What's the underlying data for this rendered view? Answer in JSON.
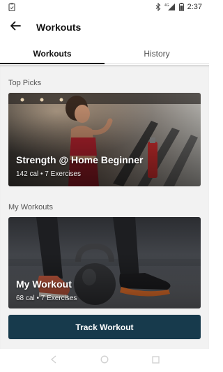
{
  "status_bar": {
    "time": "2:37",
    "network": "4G",
    "icons": [
      "clipboard-check-icon",
      "bluetooth-icon",
      "signal-icon",
      "battery-icon"
    ]
  },
  "app_bar": {
    "title": "Workouts",
    "back_icon": "arrow-left-icon"
  },
  "tabs": [
    {
      "label": "Workouts",
      "active": true
    },
    {
      "label": "History",
      "active": false
    }
  ],
  "top_picks": {
    "title": "Top Picks",
    "card": {
      "title": "Strength @ Home Beginner",
      "subtitle": "142 cal • 7 Exercises",
      "image": "woman-on-treadmill-gym-photo"
    }
  },
  "my_workouts": {
    "title": "My Workouts",
    "card": {
      "title": "My Workout",
      "subtitle": "68 cal • 7 Exercises",
      "image": "kettlebell-and-sneakers-photo"
    }
  },
  "primary_action": {
    "label": "Track Workout",
    "color": "#173a4c"
  },
  "nav_bar": {
    "icons": [
      "back-triangle-icon",
      "home-circle-icon",
      "recents-square-icon"
    ]
  }
}
